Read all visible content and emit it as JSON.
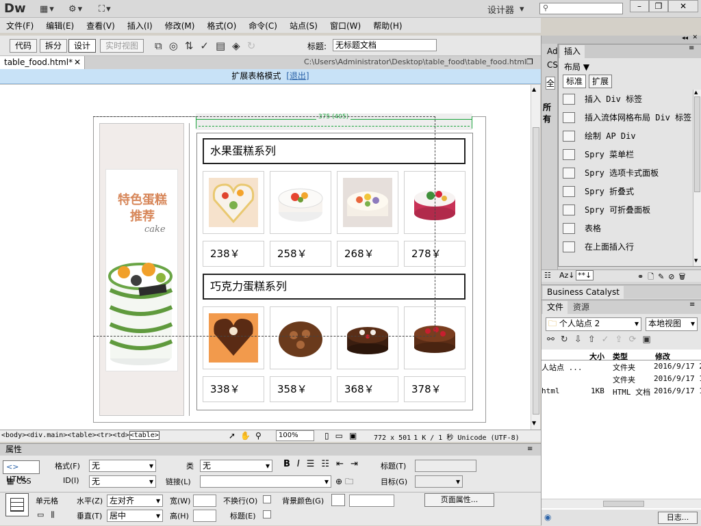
{
  "app": {
    "logo": "Dw",
    "workspace": "设计器",
    "search_placeholder": ""
  },
  "menu": [
    "文件(F)",
    "编辑(E)",
    "查看(V)",
    "插入(I)",
    "修改(M)",
    "格式(O)",
    "命令(C)",
    "站点(S)",
    "窗口(W)",
    "帮助(H)"
  ],
  "toolbar": {
    "views": [
      "代码",
      "拆分",
      "设计",
      "实时视图"
    ],
    "title_label": "标题:",
    "title_value": "无标题文档"
  },
  "document": {
    "tab_name": "table_food.html*",
    "path": "C:\\Users\\Administrator\\Desktop\\table_food\\table_food.html"
  },
  "expanded_bar": {
    "text": "扩展表格模式",
    "exit": "[退出]"
  },
  "page": {
    "width_indicator": "375 (405)",
    "sidebar_title_1": "特色蛋糕",
    "sidebar_title_2": "推荐",
    "sidebar_sub": "cake",
    "sections": [
      {
        "title": "水果蛋糕系列",
        "prices": [
          "238￥",
          "258￥",
          "268￥",
          "278￥"
        ]
      },
      {
        "title": "巧克力蛋糕系列",
        "prices": [
          "338￥",
          "358￥",
          "368￥",
          "378￥"
        ]
      }
    ]
  },
  "statusbar": {
    "tags": [
      "<body>",
      "<div.main>",
      "<table>",
      "<tr>",
      "<td>",
      "<table>"
    ],
    "zoom": "100%",
    "dims": "772 x 501",
    "size": "1 K / 1 秒",
    "encoding": "Unicode (UTF-8)"
  },
  "properties": {
    "title": "属性",
    "html_btn": "HTML",
    "css_btn": "CSS",
    "format_label": "格式(F)",
    "format_value": "无",
    "class_label": "类",
    "class_value": "无",
    "id_label": "ID(I)",
    "id_value": "无",
    "link_label": "链接(L)",
    "heading_label": "标题(T)",
    "target_label": "目标(G)",
    "cell_label": "单元格",
    "halign_label": "水平(Z)",
    "halign_value": "左对齐",
    "valign_label": "垂直(T)",
    "valign_value": "居中",
    "width_label": "宽(W)",
    "height_label": "高(H)",
    "nowrap_label": "不换行(O)",
    "header_label": "标题(E)",
    "bgcolor_label": "背景颜色(G)",
    "page_props_btn": "页面属性..."
  },
  "insert_panel": {
    "tab": "插入",
    "category": "布局",
    "modes": [
      "标准",
      "扩展"
    ],
    "items": [
      "插入 Div 标签",
      "插入流体网格布局 Div 标签",
      "绘制 AP Div",
      "Spry 菜单栏",
      "Spry 选项卡式面板",
      "Spry 折叠式",
      "Spry 可折叠面板",
      "表格",
      "在上面插入行"
    ],
    "behind_tabs": [
      "Ad",
      "CS",
      "全",
      "所有"
    ]
  },
  "bc_panel": {
    "title": "Business Catalyst"
  },
  "files_panel": {
    "tabs": [
      "文件",
      "资源"
    ],
    "site": "个人站点 2",
    "view": "本地视图",
    "headers": [
      "大小",
      "类型",
      "修改"
    ],
    "rows": [
      {
        "name": "人站点 ...",
        "size": "",
        "type": "文件夹",
        "date": "2016/9/17 2"
      },
      {
        "name": "",
        "size": "",
        "type": "文件夹",
        "date": "2016/9/17 1"
      },
      {
        "name": "html",
        "size": "1KB",
        "type": "HTML 文档",
        "date": "2016/9/17 1"
      }
    ],
    "log_btn": "日志..."
  },
  "colors": {
    "accent": "#2b63a8",
    "exp_bar": "#c8e2f7",
    "dim_line": "#19a33b",
    "cake_bg": "#f1ecea"
  }
}
